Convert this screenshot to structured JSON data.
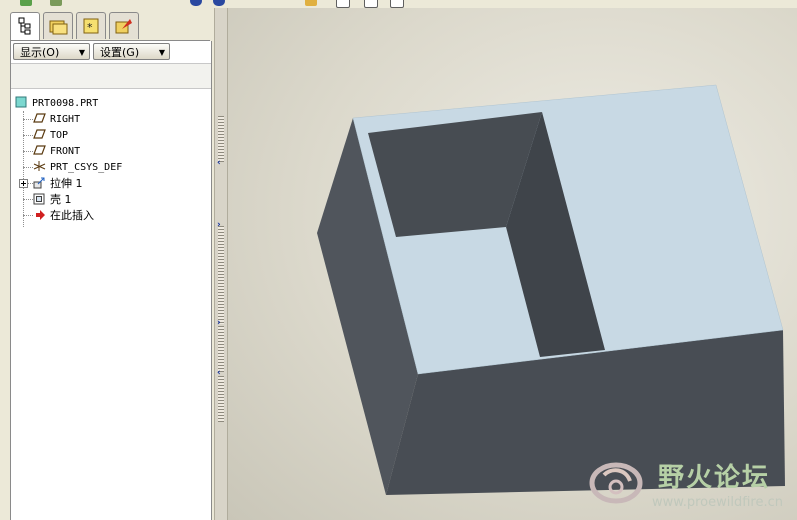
{
  "navigator": {
    "show_menu": "显示(O)",
    "settings_menu": "设置(G)",
    "tabs": [
      "model-tree",
      "folder-browser",
      "favorites",
      "connections"
    ]
  },
  "model_tree": {
    "root": "PRT0098.PRT",
    "items": [
      {
        "label": "RIGHT",
        "icon": "datum-plane-icon"
      },
      {
        "label": "TOP",
        "icon": "datum-plane-icon"
      },
      {
        "label": "FRONT",
        "icon": "datum-plane-icon"
      },
      {
        "label": "PRT_CSYS_DEF",
        "icon": "csys-icon"
      },
      {
        "label": "拉伸 1",
        "icon": "extrude-icon"
      },
      {
        "label": "壳 1",
        "icon": "shell-icon"
      },
      {
        "label": "在此插入",
        "icon": "insert-here-icon"
      }
    ]
  },
  "viewport": {
    "model_colors": {
      "top": "#c8d9e4",
      "dark": "#474c52",
      "front": "#484d54",
      "left": "#50555c"
    }
  },
  "watermark": {
    "title": "野火论坛",
    "url": "www.proewildfire.cn"
  }
}
